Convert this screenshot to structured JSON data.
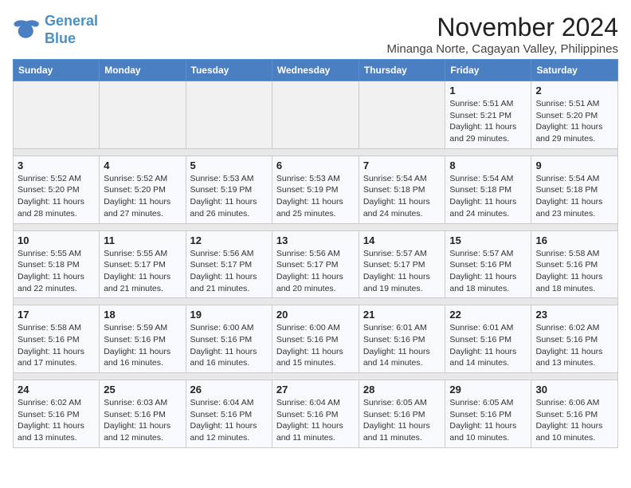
{
  "logo": {
    "line1": "General",
    "line2": "Blue"
  },
  "title": "November 2024",
  "subtitle": "Minanga Norte, Cagayan Valley, Philippines",
  "weekdays": [
    "Sunday",
    "Monday",
    "Tuesday",
    "Wednesday",
    "Thursday",
    "Friday",
    "Saturday"
  ],
  "weeks": [
    [
      {
        "day": "",
        "info": ""
      },
      {
        "day": "",
        "info": ""
      },
      {
        "day": "",
        "info": ""
      },
      {
        "day": "",
        "info": ""
      },
      {
        "day": "",
        "info": ""
      },
      {
        "day": "1",
        "info": "Sunrise: 5:51 AM\nSunset: 5:21 PM\nDaylight: 11 hours and 29 minutes."
      },
      {
        "day": "2",
        "info": "Sunrise: 5:51 AM\nSunset: 5:20 PM\nDaylight: 11 hours and 29 minutes."
      }
    ],
    [
      {
        "day": "3",
        "info": "Sunrise: 5:52 AM\nSunset: 5:20 PM\nDaylight: 11 hours and 28 minutes."
      },
      {
        "day": "4",
        "info": "Sunrise: 5:52 AM\nSunset: 5:20 PM\nDaylight: 11 hours and 27 minutes."
      },
      {
        "day": "5",
        "info": "Sunrise: 5:53 AM\nSunset: 5:19 PM\nDaylight: 11 hours and 26 minutes."
      },
      {
        "day": "6",
        "info": "Sunrise: 5:53 AM\nSunset: 5:19 PM\nDaylight: 11 hours and 25 minutes."
      },
      {
        "day": "7",
        "info": "Sunrise: 5:54 AM\nSunset: 5:18 PM\nDaylight: 11 hours and 24 minutes."
      },
      {
        "day": "8",
        "info": "Sunrise: 5:54 AM\nSunset: 5:18 PM\nDaylight: 11 hours and 24 minutes."
      },
      {
        "day": "9",
        "info": "Sunrise: 5:54 AM\nSunset: 5:18 PM\nDaylight: 11 hours and 23 minutes."
      }
    ],
    [
      {
        "day": "10",
        "info": "Sunrise: 5:55 AM\nSunset: 5:18 PM\nDaylight: 11 hours and 22 minutes."
      },
      {
        "day": "11",
        "info": "Sunrise: 5:55 AM\nSunset: 5:17 PM\nDaylight: 11 hours and 21 minutes."
      },
      {
        "day": "12",
        "info": "Sunrise: 5:56 AM\nSunset: 5:17 PM\nDaylight: 11 hours and 21 minutes."
      },
      {
        "day": "13",
        "info": "Sunrise: 5:56 AM\nSunset: 5:17 PM\nDaylight: 11 hours and 20 minutes."
      },
      {
        "day": "14",
        "info": "Sunrise: 5:57 AM\nSunset: 5:17 PM\nDaylight: 11 hours and 19 minutes."
      },
      {
        "day": "15",
        "info": "Sunrise: 5:57 AM\nSunset: 5:16 PM\nDaylight: 11 hours and 18 minutes."
      },
      {
        "day": "16",
        "info": "Sunrise: 5:58 AM\nSunset: 5:16 PM\nDaylight: 11 hours and 18 minutes."
      }
    ],
    [
      {
        "day": "17",
        "info": "Sunrise: 5:58 AM\nSunset: 5:16 PM\nDaylight: 11 hours and 17 minutes."
      },
      {
        "day": "18",
        "info": "Sunrise: 5:59 AM\nSunset: 5:16 PM\nDaylight: 11 hours and 16 minutes."
      },
      {
        "day": "19",
        "info": "Sunrise: 6:00 AM\nSunset: 5:16 PM\nDaylight: 11 hours and 16 minutes."
      },
      {
        "day": "20",
        "info": "Sunrise: 6:00 AM\nSunset: 5:16 PM\nDaylight: 11 hours and 15 minutes."
      },
      {
        "day": "21",
        "info": "Sunrise: 6:01 AM\nSunset: 5:16 PM\nDaylight: 11 hours and 14 minutes."
      },
      {
        "day": "22",
        "info": "Sunrise: 6:01 AM\nSunset: 5:16 PM\nDaylight: 11 hours and 14 minutes."
      },
      {
        "day": "23",
        "info": "Sunrise: 6:02 AM\nSunset: 5:16 PM\nDaylight: 11 hours and 13 minutes."
      }
    ],
    [
      {
        "day": "24",
        "info": "Sunrise: 6:02 AM\nSunset: 5:16 PM\nDaylight: 11 hours and 13 minutes."
      },
      {
        "day": "25",
        "info": "Sunrise: 6:03 AM\nSunset: 5:16 PM\nDaylight: 11 hours and 12 minutes."
      },
      {
        "day": "26",
        "info": "Sunrise: 6:04 AM\nSunset: 5:16 PM\nDaylight: 11 hours and 12 minutes."
      },
      {
        "day": "27",
        "info": "Sunrise: 6:04 AM\nSunset: 5:16 PM\nDaylight: 11 hours and 11 minutes."
      },
      {
        "day": "28",
        "info": "Sunrise: 6:05 AM\nSunset: 5:16 PM\nDaylight: 11 hours and 11 minutes."
      },
      {
        "day": "29",
        "info": "Sunrise: 6:05 AM\nSunset: 5:16 PM\nDaylight: 11 hours and 10 minutes."
      },
      {
        "day": "30",
        "info": "Sunrise: 6:06 AM\nSunset: 5:16 PM\nDaylight: 11 hours and 10 minutes."
      }
    ]
  ]
}
